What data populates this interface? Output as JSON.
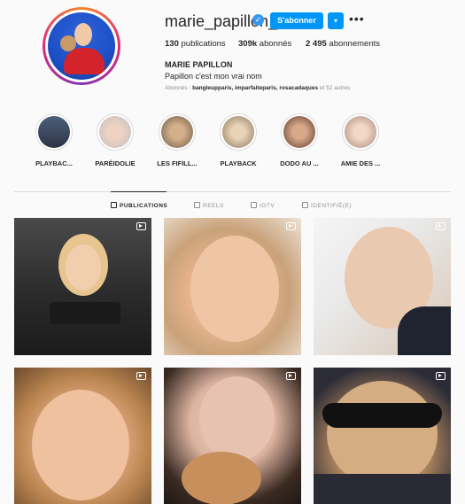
{
  "profile": {
    "username": "marie_papillon_",
    "follow_label": "S'abonner",
    "dropdown_glyph": "▾",
    "more_glyph": "•••",
    "verified_glyph": "✓",
    "stats": {
      "publications": "130",
      "publications_label": "publications",
      "followers": "309k",
      "followers_label": "abonnés",
      "following": "2 495",
      "following_label": "abonnements"
    },
    "full_name": "MARIE PAPILLON",
    "bio": "Papillon c'est mon vrai nom",
    "followed_by_prefix": "Abonnés :",
    "followed_by_names": "bangleupparis, imparfaiteparis, rosacadaques",
    "followed_by_suffix": "et 52 autres"
  },
  "highlights": [
    {
      "label": "PLAYBAC...",
      "color": "#3b3f5c"
    },
    {
      "label": "PARÉIDOLIE",
      "color": "#cfcfcf"
    },
    {
      "label": "LES FIFILL...",
      "color": "#8a7a6a"
    },
    {
      "label": "PLAYBACK",
      "color": "#b9a48c"
    },
    {
      "label": "DODO AU ...",
      "color": "#7d5b4a"
    },
    {
      "label": "AMIE DES ...",
      "color": "#e6c7b6"
    }
  ],
  "tabs": [
    {
      "label": "PUBLICATIONS",
      "active": true
    },
    {
      "label": "REELS",
      "active": false
    },
    {
      "label": "IGTV",
      "active": false
    },
    {
      "label": "IDENTIFIÉ(E)",
      "active": false
    }
  ],
  "posts": [
    {
      "type": "reel"
    },
    {
      "type": "reel"
    },
    {
      "type": "reel"
    },
    {
      "type": "reel"
    },
    {
      "type": "reel"
    },
    {
      "type": "reel"
    }
  ],
  "colors": {
    "accent": "#0095f6",
    "text": "#262626",
    "muted": "#8e8e8e",
    "border": "#dbdbdb",
    "background": "#fafafa"
  }
}
